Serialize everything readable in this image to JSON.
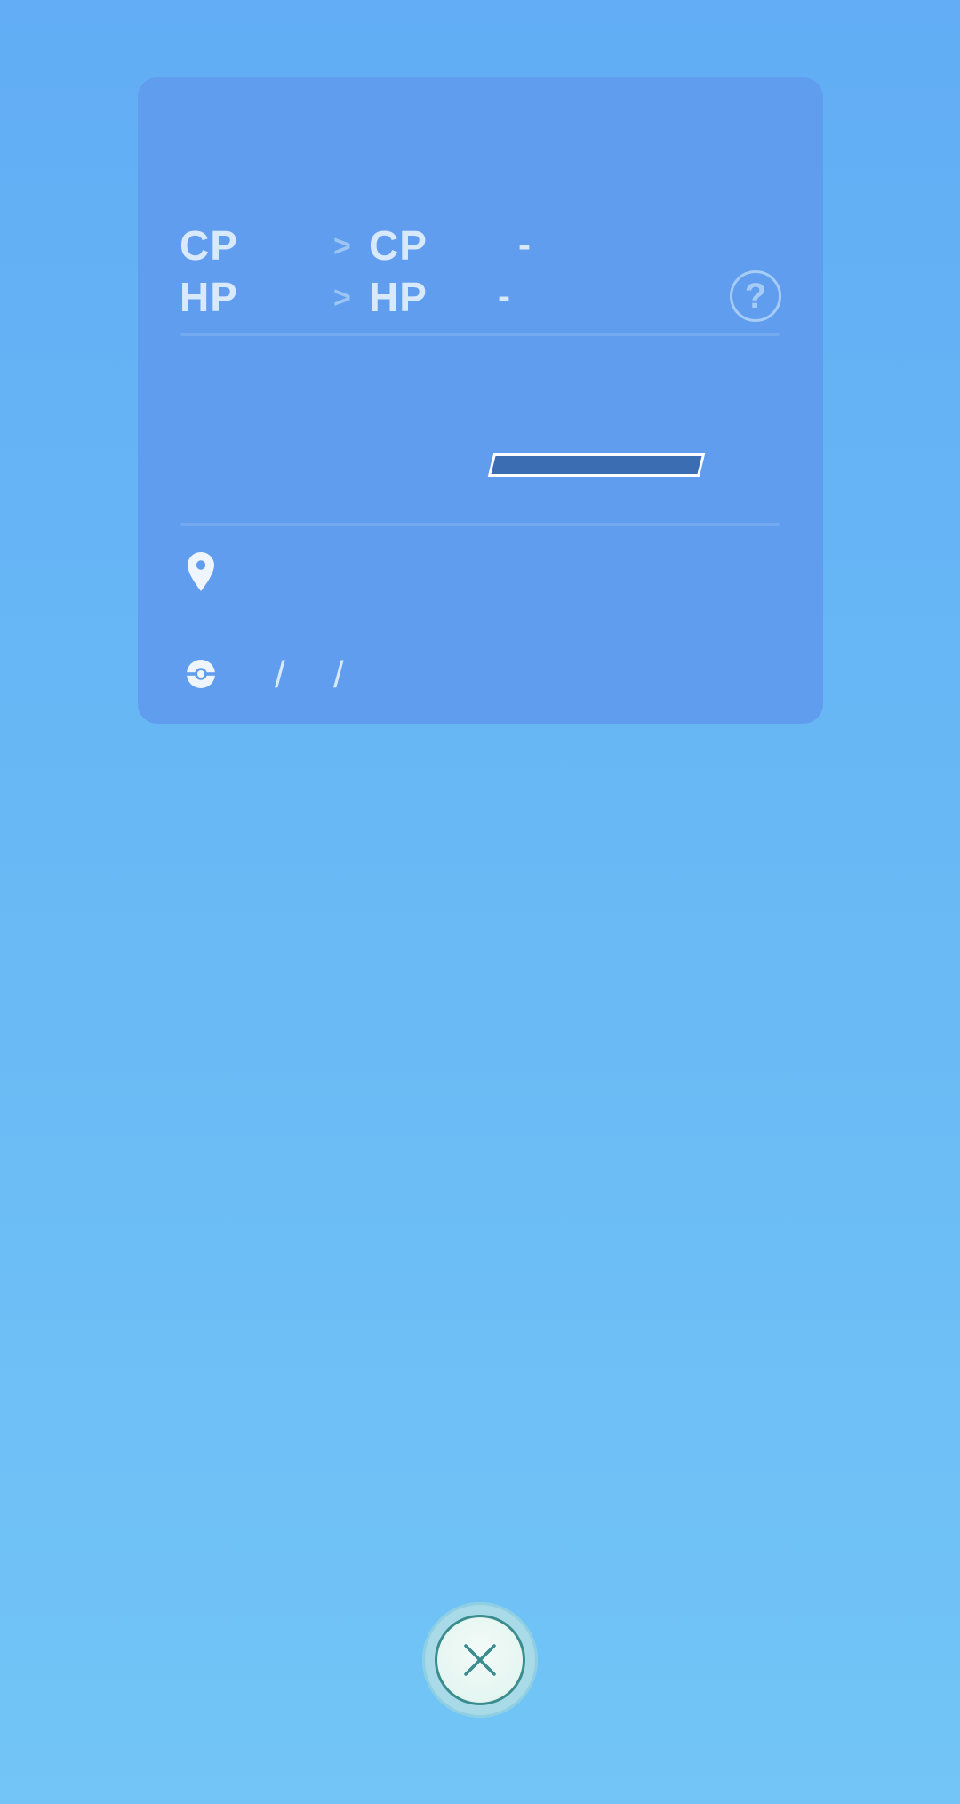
{
  "stats": {
    "cp_label": "CP",
    "cp_arrow": ">",
    "cp_label_new": "CP",
    "cp_dash": "-",
    "hp_label": "HP",
    "hp_arrow": ">",
    "hp_label_new": "HP",
    "hp_dash": "-",
    "help_text": "?"
  },
  "progress": {
    "fill_fraction": 1.0
  },
  "caught": {
    "date_separator_1": "/",
    "date_separator_2": "/"
  },
  "icons": {
    "help": "question-circle-icon",
    "location": "location-pin-icon",
    "ball": "pokeball-icon",
    "close": "close-x-icon"
  },
  "colors": {
    "background_top": "#62adf5",
    "card": "#619dee",
    "bar_fill": "#3a6db2",
    "close_accent": "#3b8c8e"
  }
}
